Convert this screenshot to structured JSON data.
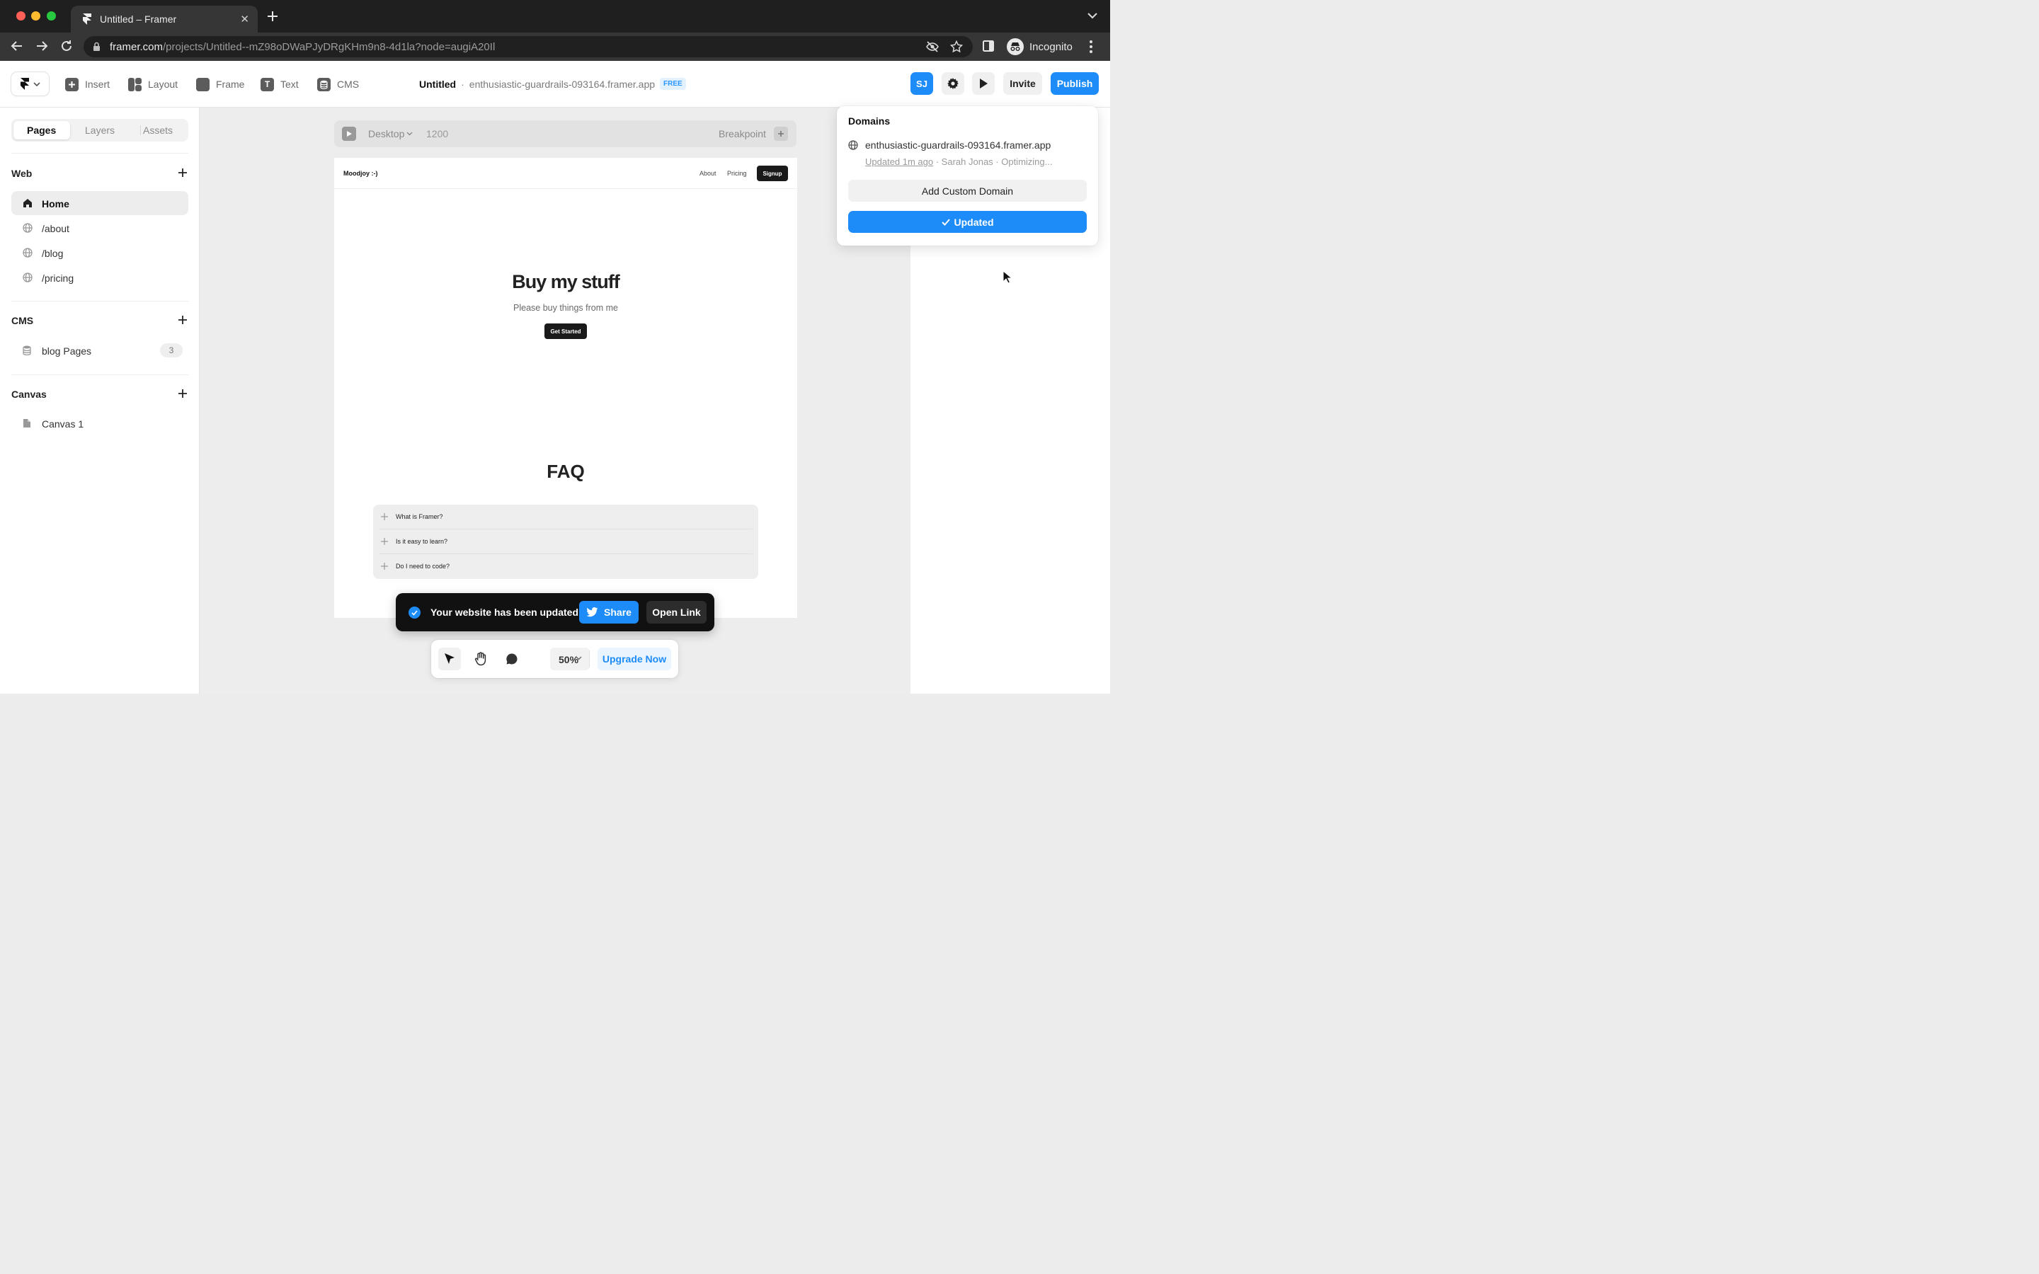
{
  "browser": {
    "tab_title": "Untitled – Framer",
    "url_host": "framer.com",
    "url_path": "/projects/Untitled--mZ98oDWaPJyDRgKHm9n8-4d1la?node=augiA20Il",
    "profile_label": "Incognito"
  },
  "toolbar": {
    "insert_label": "Insert",
    "layout_label": "Layout",
    "frame_label": "Frame",
    "text_label": "Text",
    "cms_label": "CMS",
    "project_name": "Untitled",
    "separator": "·",
    "project_domain": "enthusiastic-guardrails-093164.framer.app",
    "plan_badge": "FREE",
    "user_initials": "SJ",
    "invite_label": "Invite",
    "publish_label": "Publish"
  },
  "left_panel": {
    "tabs": [
      "Pages",
      "Layers",
      "Assets"
    ],
    "web_title": "Web",
    "pages": [
      {
        "label": "Home",
        "active": true
      },
      {
        "label": "/about"
      },
      {
        "label": "/blog"
      },
      {
        "label": "/pricing"
      }
    ],
    "cms_title": "CMS",
    "cms_items": [
      {
        "label": "blog Pages",
        "count": "3"
      }
    ],
    "canvas_title": "Canvas",
    "canvas_items": [
      {
        "label": "Canvas 1"
      }
    ]
  },
  "canvas": {
    "device": "Desktop",
    "width": "1200",
    "breakpoint_label": "Breakpoint",
    "site": {
      "logo": "Moodjoy :-)",
      "nav_links": [
        "About",
        "Pricing"
      ],
      "signup": "Signup",
      "hero_title": "Buy my stuff",
      "hero_subtitle": "Please buy things from me",
      "cta": "Get Started",
      "faq_title": "FAQ",
      "faq_items": [
        "What is Framer?",
        "Is it easy to learn?",
        "Do I need to code?"
      ]
    }
  },
  "domains_popover": {
    "title": "Domains",
    "domain": "enthusiastic-guardrails-093164.framer.app",
    "updated": "Updated 1m ago",
    "meta": " · Sarah Jonas · Optimizing...",
    "add_custom": "Add Custom Domain",
    "status_button": "Updated"
  },
  "toast": {
    "message": "Your website has been updated",
    "share": "Share",
    "open_link": "Open Link"
  },
  "bottom_bar": {
    "zoom": "50%",
    "upgrade": "Upgrade Now"
  },
  "colors": {
    "accent": "#1d8cf8",
    "browser_dark": "#1f1f1f",
    "canvas_bg": "#ededed"
  }
}
